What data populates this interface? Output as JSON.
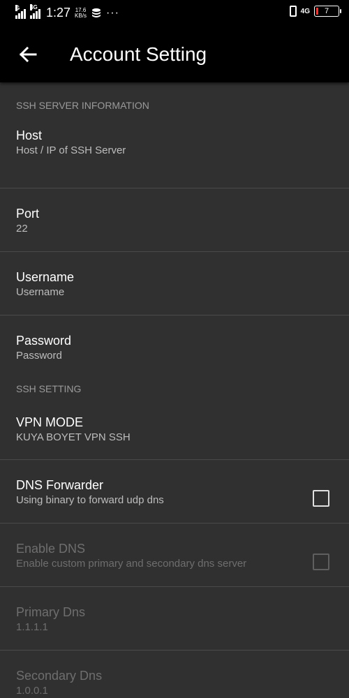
{
  "status_bar": {
    "network_tag_1": "G",
    "network_tag_2": "4G",
    "time": "1:27",
    "speed_value": "17.6",
    "speed_unit": "KB/s",
    "more": "···",
    "net_type": "4G",
    "battery_level": "7"
  },
  "app_bar": {
    "title": "Account Setting",
    "back_icon": "arrow-back-icon"
  },
  "sections": {
    "ssh_server": {
      "header": "SSH SERVER INFORMATION",
      "items": [
        {
          "title": "Host",
          "summary": "Host / IP of SSH Server"
        },
        {
          "title": "Port",
          "summary": "22"
        },
        {
          "title": "Username",
          "summary": "Username"
        },
        {
          "title": "Password",
          "summary": "Password"
        }
      ]
    },
    "ssh_setting": {
      "header": "SSH SETTING",
      "items": [
        {
          "title": "VPN MODE",
          "summary": "KUYA BOYET VPN SSH"
        },
        {
          "title": "DNS Forwarder",
          "summary": "Using binary to forward udp dns",
          "checked": false,
          "enabled": true
        },
        {
          "title": "Enable DNS",
          "summary": "Enable custom primary and secondary dns server",
          "checked": false,
          "enabled": false
        },
        {
          "title": "Primary Dns",
          "summary": "1.1.1.1",
          "enabled": false
        },
        {
          "title": "Secondary Dns",
          "summary": "1.0.0.1",
          "enabled": false
        }
      ]
    }
  },
  "colors": {
    "background": "#303030",
    "app_bar": "#000000",
    "divider": "#4a4a4a",
    "section_header": "#9a9a9a",
    "disabled_text": "#6e6e6e"
  }
}
